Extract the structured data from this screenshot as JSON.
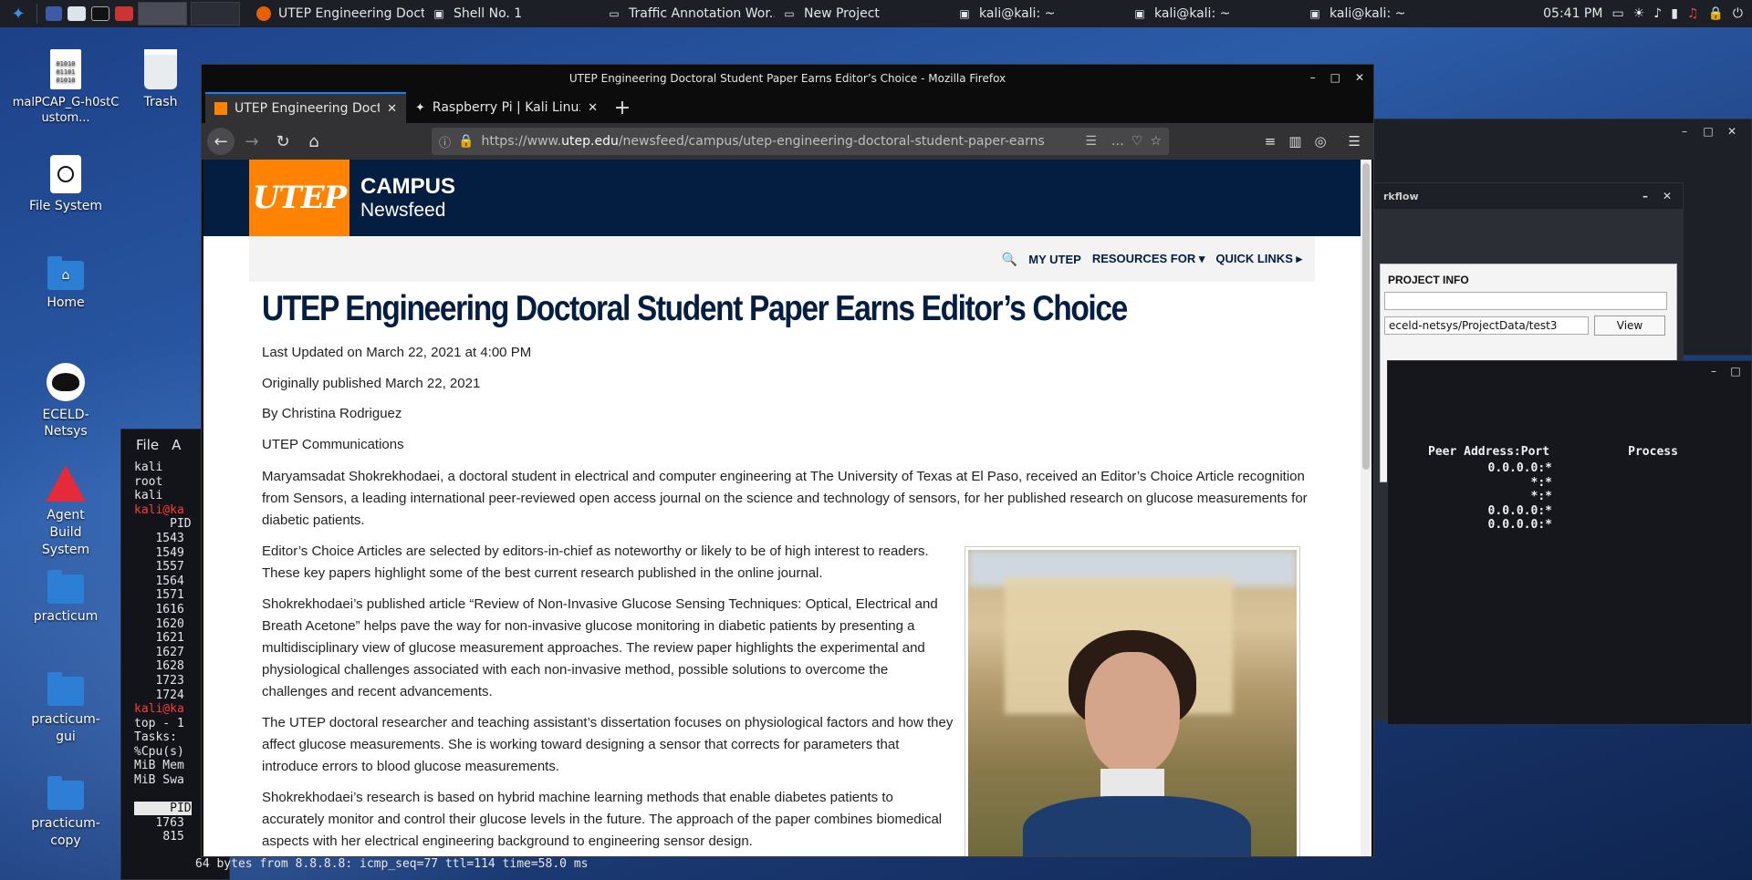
{
  "taskbar": {
    "tasks": [
      {
        "label": "UTEP Engineering Doct...",
        "icon": "firefox-icon"
      },
      {
        "label": "Shell No. 1",
        "icon": "terminal-icon"
      },
      {
        "label": "Traffic Annotation Wor...",
        "icon": "window-icon"
      },
      {
        "label": "New Project",
        "icon": "window-icon"
      },
      {
        "label": "kali@kali: ~",
        "icon": "terminal-icon"
      },
      {
        "label": "kali@kali: ~",
        "icon": "terminal-icon"
      },
      {
        "label": "kali@kali: ~",
        "icon": "terminal-icon"
      }
    ],
    "clock": "05:41 PM"
  },
  "desktop_icons": [
    {
      "label": "malPCAP_G-h0stCustom...",
      "icon": "binary-file-icon"
    },
    {
      "label": "Trash",
      "icon": "trash-icon"
    },
    {
      "label": "File System",
      "icon": "drive-icon"
    },
    {
      "label": "Home",
      "icon": "home-folder-icon"
    },
    {
      "label": "ECELD-Netsys",
      "icon": "spy-icon"
    },
    {
      "label": "Agent Build System",
      "icon": "agent-icon"
    },
    {
      "label": "practicum",
      "icon": "folder-icon"
    },
    {
      "label": "practicum-gui",
      "icon": "folder-icon"
    },
    {
      "label": "practicum-copy",
      "icon": "folder-icon"
    }
  ],
  "terminal": {
    "menu": [
      "File",
      "A"
    ],
    "lines_before_prompt": [
      "kali",
      "root",
      "kali"
    ],
    "prompt": "kali@ka",
    "pid_header": "PID",
    "pids": [
      "1543",
      "1549",
      "1557",
      "1564",
      "1571",
      "1616",
      "1620",
      "1621",
      "1627",
      "1628",
      "1723",
      "1724"
    ],
    "prompt2": "kali@ka",
    "top_lines": [
      "top - 1",
      "Tasks:",
      "%Cpu(s)",
      "MiB Mem",
      "MiB Swa"
    ],
    "pid_header2": "PID",
    "pids2": [
      "1763",
      "815"
    ],
    "ping": "64 bytes from 8.8.8.8: icmp_seq=77 ttl=114 time=58.0 ms"
  },
  "right_windows": {
    "workflow_title": "rkflow",
    "project_info": "PROJECT INFO",
    "path_value": "eceld-netsys/ProjectData/test3",
    "view_label": "View",
    "netstat_header": {
      "peer": "Peer Address:Port",
      "process": "Process"
    },
    "netstat_rows": [
      "0.0.0.0:*",
      "*:*",
      "*:*",
      "0.0.0.0:*",
      "0.0.0.0:*"
    ]
  },
  "firefox": {
    "window_title": "UTEP Engineering Doctoral Student Paper Earns Editor’s Choice - Mozilla Firefox",
    "tabs": [
      {
        "label": "UTEP Engineering Doctor",
        "icon": "utep-favicon-icon",
        "selected": true
      },
      {
        "label": "Raspberry Pi | Kali Linux D",
        "icon": "kali-favicon-icon",
        "selected": false
      }
    ],
    "url_prefix": "https://www.",
    "url_domain": "utep.edu",
    "url_path": "/newsfeed/campus/utep-engineering-doctoral-student-paper-earns",
    "page": {
      "logo_text": "UTEP",
      "campus": "CAMPUS",
      "newsfeed": "Newsfeed",
      "nav": [
        "MY UTEP",
        "RESOURCES FOR ▾",
        "QUICK LINKS ▸"
      ],
      "headline": "UTEP Engineering Doctoral Student Paper Earns Editor’s Choice",
      "last_updated": "Last Updated on March 22, 2021 at 4:00 PM",
      "published": "Originally published March 22, 2021",
      "byline": "By Christina Rodriguez",
      "dept": "UTEP Communications",
      "paragraphs": [
        "Maryamsadat Shokrekhodaei, a doctoral student in electrical and computer engineering at The University of Texas at El Paso, received an Editor’s Choice Article recognition from Sensors, a leading international peer-reviewed open access journal on the science and technology of sensors, for her published research on glucose measurements for diabetic patients.",
        "Editor’s Choice Articles are selected by editors-in-chief as noteworthy or likely to be of high interest to readers. These key papers highlight some of the best current research published in the online journal.",
        "Shokrekhodaei’s published article “Review of Non-Invasive Glucose Sensing Techniques: Optical, Electrical and Breath Acetone” helps pave the way for non-invasive glucose monitoring in diabetic patients by presenting a multidisciplinary view of glucose measurement approaches. The review paper highlights the experimental and physiological challenges associated with each non-invasive method, possible solutions to overcome the challenges and recent advancements.",
        "The UTEP doctoral researcher and teaching assistant’s dissertation focuses on physiological factors and how they affect glucose measurements. She is working toward designing a sensor that corrects for parameters that introduce errors to blood glucose measurements.",
        "Shokrekhodaei’s research is based on hybrid machine learning methods that enable diabetes patients to accurately monitor and control their glucose levels in the future. The approach of the paper combines biomedical aspects with her electrical engineering background to engineering sensor design."
      ]
    }
  }
}
